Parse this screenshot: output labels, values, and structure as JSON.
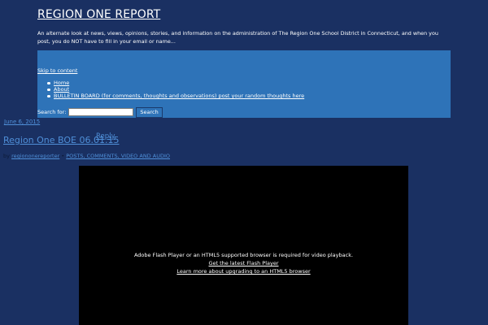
{
  "header": {
    "title": "REGION ONE REPORT",
    "description": "An alternate look at news, views, opinions, stories, and information on the administration of The Region One School District in Connecticut, and when you post, you do NOT have to fill in your email or name..."
  },
  "nav": {
    "skip_link": "Skip to content",
    "menu": [
      {
        "label": "Home"
      },
      {
        "label": "About"
      },
      {
        "label": "BULLETIN BOARD (for comments, thoughts and observations) post your random thoughts here"
      }
    ]
  },
  "search": {
    "label": "Search for:",
    "value": "",
    "button_label": "Search"
  },
  "post": {
    "date": "June 6, 2015",
    "title": "Region One BOE 06.01.15",
    "reply_label": "Reply",
    "by_label": "by",
    "author": "regiononereporter",
    "separator": "•",
    "category": "POSTS, COMMENTS, VIDEO AND AUDIO"
  },
  "video": {
    "message": "Adobe Flash Player or an HTML5 supported browser is required for video playback.",
    "flash_link": "Get the latest Flash Player",
    "html5_link": "Learn more about upgrading to an HTML5 browser"
  },
  "colors": {
    "page_background": "#1a3062",
    "nav_background": "#2e73b8",
    "link": "#4f8fd8",
    "video_background": "#000000"
  }
}
